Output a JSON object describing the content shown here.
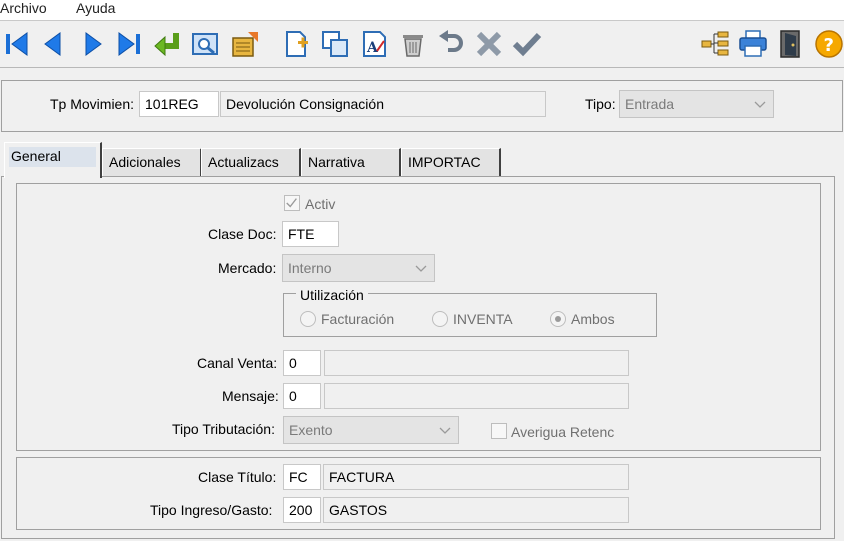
{
  "menu": {
    "file": "Archivo",
    "help": "Ayuda"
  },
  "toolbar": {
    "buttons": [
      "first-icon",
      "prev-icon",
      "next-icon",
      "last-icon",
      "enter-icon",
      "preview-icon",
      "export-icon",
      "new-doc-icon",
      "copy-icon",
      "spellcheck-icon",
      "trash-icon",
      "undo-icon",
      "cancel-icon",
      "confirm-icon",
      "tree-icon",
      "print-icon",
      "exit-door-icon",
      "help-icon"
    ]
  },
  "header": {
    "tp_movimiento_label": "Tp Movimien:",
    "tp_movimiento_code": "101REG",
    "tp_movimiento_desc": "Devolución Consignación",
    "tipo_label": "Tipo:",
    "tipo_value": "Entrada"
  },
  "tabs": [
    {
      "label": "General",
      "active": true
    },
    {
      "label": "Adicionales"
    },
    {
      "label": "Actualizacs"
    },
    {
      "label": "Narrativa"
    },
    {
      "label": "IMPORTAC"
    }
  ],
  "general": {
    "activ_label": "Activ",
    "activ_checked": true,
    "clase_doc_label": "Clase Doc:",
    "clase_doc_value": "FTE",
    "mercado_label": "Mercado:",
    "mercado_value": "Interno",
    "utilizacion_title": "Utilización",
    "utilizacion_options": [
      "Facturación",
      "INVENTA",
      "Ambos"
    ],
    "utilizacion_selected": "Ambos",
    "canal_venta_label": "Canal Venta:",
    "canal_venta_code": "0",
    "canal_venta_desc": "",
    "mensaje_label": "Mensaje:",
    "mensaje_code": "0",
    "mensaje_desc": "",
    "tipo_tributacion_label": "Tipo Tributación:",
    "tipo_tributacion_value": "Exento",
    "averigua_retenc_label": "Averigua Retenc",
    "averigua_retenc_checked": false
  },
  "footer": {
    "clase_titulo_label": "Clase Título:",
    "clase_titulo_code": "FC",
    "clase_titulo_desc": "FACTURA",
    "tipo_ingreso_label": "Tipo Ingreso/Gasto:",
    "tipo_ingreso_code": "200",
    "tipo_ingreso_desc": "GASTOS"
  }
}
